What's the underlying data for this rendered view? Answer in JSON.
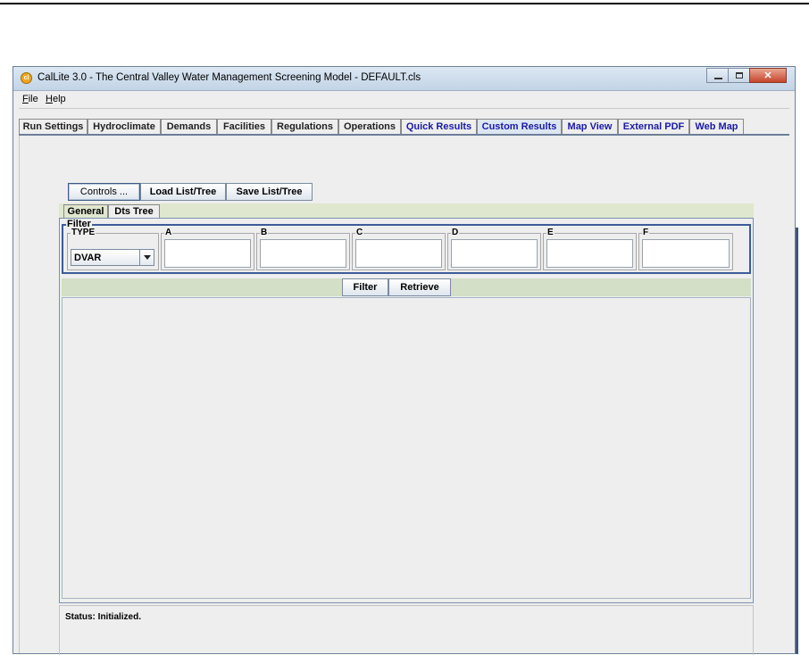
{
  "window": {
    "title": "CalLite 3.0 -  The Central Valley Water Management Screening Model - DEFAULT.cls",
    "icon_text": "cl"
  },
  "menu": {
    "file": {
      "mnemonic": "F",
      "rest": "ile"
    },
    "help": {
      "mnemonic": "H",
      "rest": "elp"
    }
  },
  "tabs": [
    {
      "label": "Run Settings"
    },
    {
      "label": "Hydroclimate"
    },
    {
      "label": "Demands"
    },
    {
      "label": "Facilities"
    },
    {
      "label": "Regulations"
    },
    {
      "label": "Operations"
    },
    {
      "label": "Quick Results"
    },
    {
      "label": "Custom Results",
      "selected": true
    },
    {
      "label": "Map View"
    },
    {
      "label": "External PDF"
    },
    {
      "label": "Web Map"
    }
  ],
  "toolbar": {
    "controls_label": "Controls ...",
    "load_label": "Load List/Tree",
    "save_label": "Save List/Tree"
  },
  "subtabs": [
    {
      "label": "General",
      "selected": true
    },
    {
      "label": "Dts Tree"
    }
  ],
  "filter": {
    "legend": "Filter",
    "type_label": "TYPE",
    "type_value": "DVAR",
    "fields": [
      {
        "label": "A",
        "value": ""
      },
      {
        "label": "B",
        "value": ""
      },
      {
        "label": "C",
        "value": ""
      },
      {
        "label": "D",
        "value": ""
      },
      {
        "label": "E",
        "value": ""
      },
      {
        "label": "F",
        "value": ""
      }
    ],
    "filter_button": "Filter",
    "retrieve_button": "Retrieve"
  },
  "status": {
    "text": "Status: Initialized."
  },
  "colors": {
    "tab_blue_text": "#1a1aa6",
    "filter_border": "#3d5a99",
    "subtab_bar": "#dfe7cf"
  }
}
